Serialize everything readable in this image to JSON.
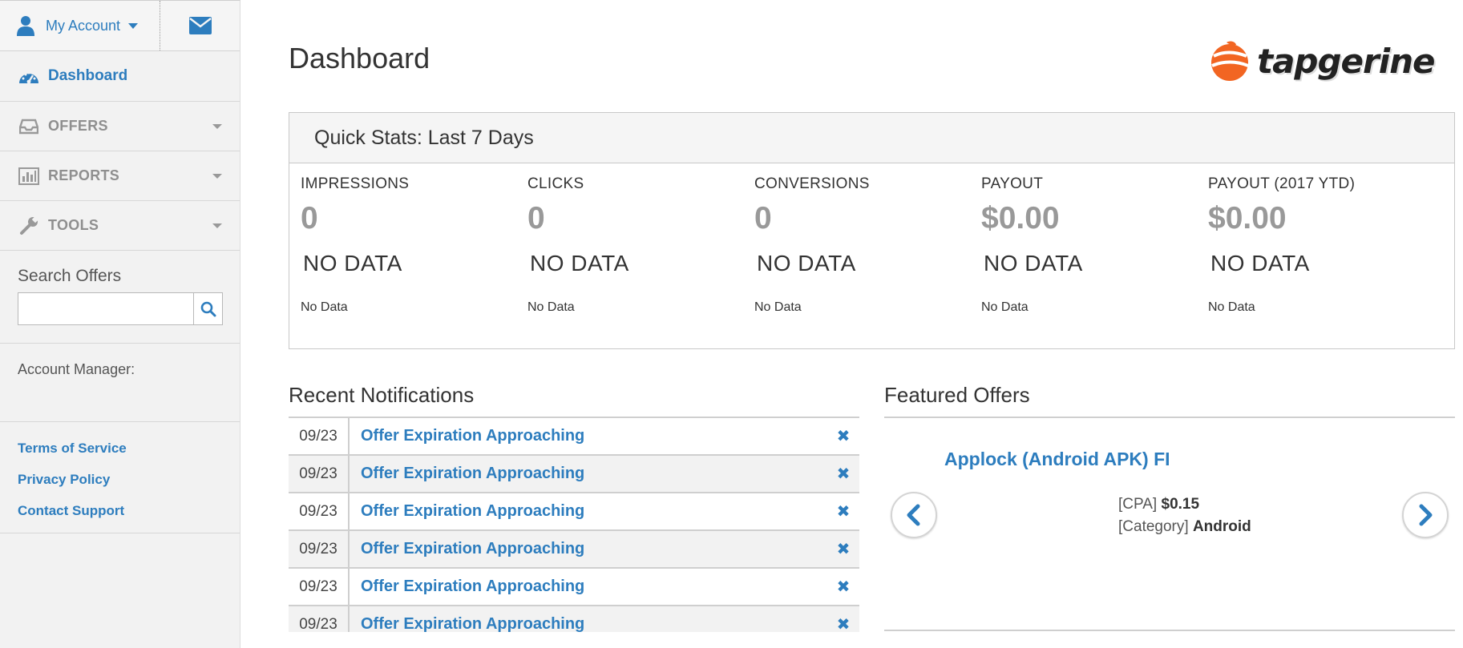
{
  "colors": {
    "accent": "#2d7dbe",
    "sidebar_bg": "#f2f2f2",
    "muted": "#999999",
    "logo_orange": "#f26522"
  },
  "sidebar": {
    "account_label": "My Account",
    "nav": [
      {
        "label": "Dashboard",
        "icon": "dashboard-gauge-icon"
      },
      {
        "label": "OFFERS",
        "icon": "inbox-tray-icon"
      },
      {
        "label": "REPORTS",
        "icon": "bar-chart-icon"
      },
      {
        "label": "TOOLS",
        "icon": "wrench-icon"
      }
    ],
    "search_label": "Search Offers",
    "search_value": "",
    "account_manager_label": "Account Manager:",
    "links": [
      "Terms of Service",
      "Privacy Policy",
      "Contact Support"
    ]
  },
  "main": {
    "title": "Dashboard",
    "logo_text": "tapgerine",
    "quick_stats": {
      "title": "Quick Stats: Last 7 Days",
      "items": [
        {
          "label": "IMPRESSIONS",
          "value": "0",
          "status": "NO DATA",
          "note": "No Data"
        },
        {
          "label": "CLICKS",
          "value": "0",
          "status": "NO DATA",
          "note": "No Data"
        },
        {
          "label": "CONVERSIONS",
          "value": "0",
          "status": "NO DATA",
          "note": "No Data"
        },
        {
          "label": "PAYOUT",
          "value": "$0.00",
          "status": "NO DATA",
          "note": "No Data"
        },
        {
          "label": "PAYOUT (2017 YTD)",
          "value": "$0.00",
          "status": "NO DATA",
          "note": "No Data"
        }
      ]
    },
    "notifications": {
      "title": "Recent Notifications",
      "rows": [
        {
          "date": "09/23",
          "text": "Offer Expiration Approaching",
          "close": "✖"
        },
        {
          "date": "09/23",
          "text": "Offer Expiration Approaching",
          "close": "✖"
        },
        {
          "date": "09/23",
          "text": "Offer Expiration Approaching",
          "close": "✖"
        },
        {
          "date": "09/23",
          "text": "Offer Expiration Approaching",
          "close": "✖"
        },
        {
          "date": "09/23",
          "text": "Offer Expiration Approaching",
          "close": "✖"
        },
        {
          "date": "09/23",
          "text": "Offer Expiration Approaching",
          "close": "✖"
        }
      ]
    },
    "featured": {
      "title": "Featured Offers",
      "offer_name": "Applock (Android APK) FI",
      "cpa_label": "[CPA]",
      "cpa_value": "$0.15",
      "category_label": "[Category]",
      "category_value": "Android"
    }
  }
}
